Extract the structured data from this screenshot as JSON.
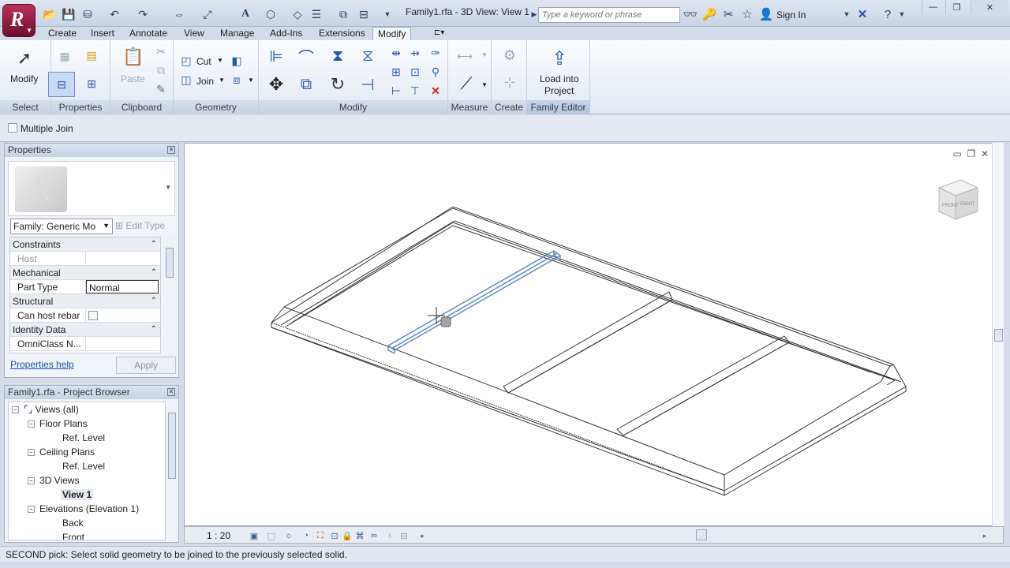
{
  "titlebar": {
    "document_title": "Family1.rfa - 3D View: View 1",
    "search_placeholder": "Type a keyword or phrase",
    "sign_in": "Sign In"
  },
  "tabs": [
    {
      "label": "Create"
    },
    {
      "label": "Insert"
    },
    {
      "label": "Annotate"
    },
    {
      "label": "View"
    },
    {
      "label": "Manage"
    },
    {
      "label": "Add-Ins"
    },
    {
      "label": "Extensions"
    },
    {
      "label": "Modify",
      "active": true
    }
  ],
  "ribbon": {
    "select": {
      "modify_label": "Modify",
      "panel_label": "Select"
    },
    "properties": {
      "panel_label": "Properties"
    },
    "clipboard": {
      "paste_label": "Paste",
      "panel_label": "Clipboard"
    },
    "geometry": {
      "cut_label": "Cut",
      "join_label": "Join",
      "panel_label": "Geometry"
    },
    "modify": {
      "panel_label": "Modify"
    },
    "measure": {
      "panel_label": "Measure"
    },
    "create": {
      "panel_label": "Create"
    },
    "family_editor": {
      "load_label_1": "Load into",
      "load_label_2": "Project",
      "panel_label": "Family Editor"
    }
  },
  "options_bar": {
    "multiple_join_label": "Multiple Join",
    "multiple_join_checked": false
  },
  "properties_palette": {
    "title": "Properties",
    "family_select": "Family: Generic Mo",
    "edit_type": "Edit Type",
    "groups": [
      {
        "name": "Constraints",
        "rows": [
          {
            "name": "Host",
            "value": ""
          }
        ]
      },
      {
        "name": "Mechanical",
        "rows": [
          {
            "name": "Part Type",
            "value": "Normal"
          }
        ]
      },
      {
        "name": "Structural",
        "rows": [
          {
            "name": "Can host rebar",
            "value": ""
          }
        ]
      },
      {
        "name": "Identity Data",
        "rows": [
          {
            "name": "OmniClass N...",
            "value": ""
          }
        ]
      }
    ],
    "help_link": "Properties help",
    "apply_label": "Apply"
  },
  "project_browser": {
    "title": "Family1.rfa - Project Browser",
    "nodes": [
      {
        "label": "Views (all)"
      },
      {
        "label": "Floor Plans"
      },
      {
        "label": "Ref. Level"
      },
      {
        "label": "Ceiling Plans"
      },
      {
        "label": "Ref. Level"
      },
      {
        "label": "3D Views"
      },
      {
        "label": "View 1"
      },
      {
        "label": "Elevations (Elevation 1)"
      },
      {
        "label": "Back"
      },
      {
        "label": "Front"
      }
    ]
  },
  "viewport": {
    "view_cube_front": "FRONT",
    "view_cube_right": "RIGHT"
  },
  "view_control_bar": {
    "scale": "1 : 20"
  },
  "status_bar": {
    "message": "SECOND pick: Select solid geometry to be joined to the previously selected solid."
  },
  "colors": {
    "selection_blue": "#5b86c5",
    "app_button": "#8a1c3d",
    "ribbon_bg": "#eef2f8"
  }
}
